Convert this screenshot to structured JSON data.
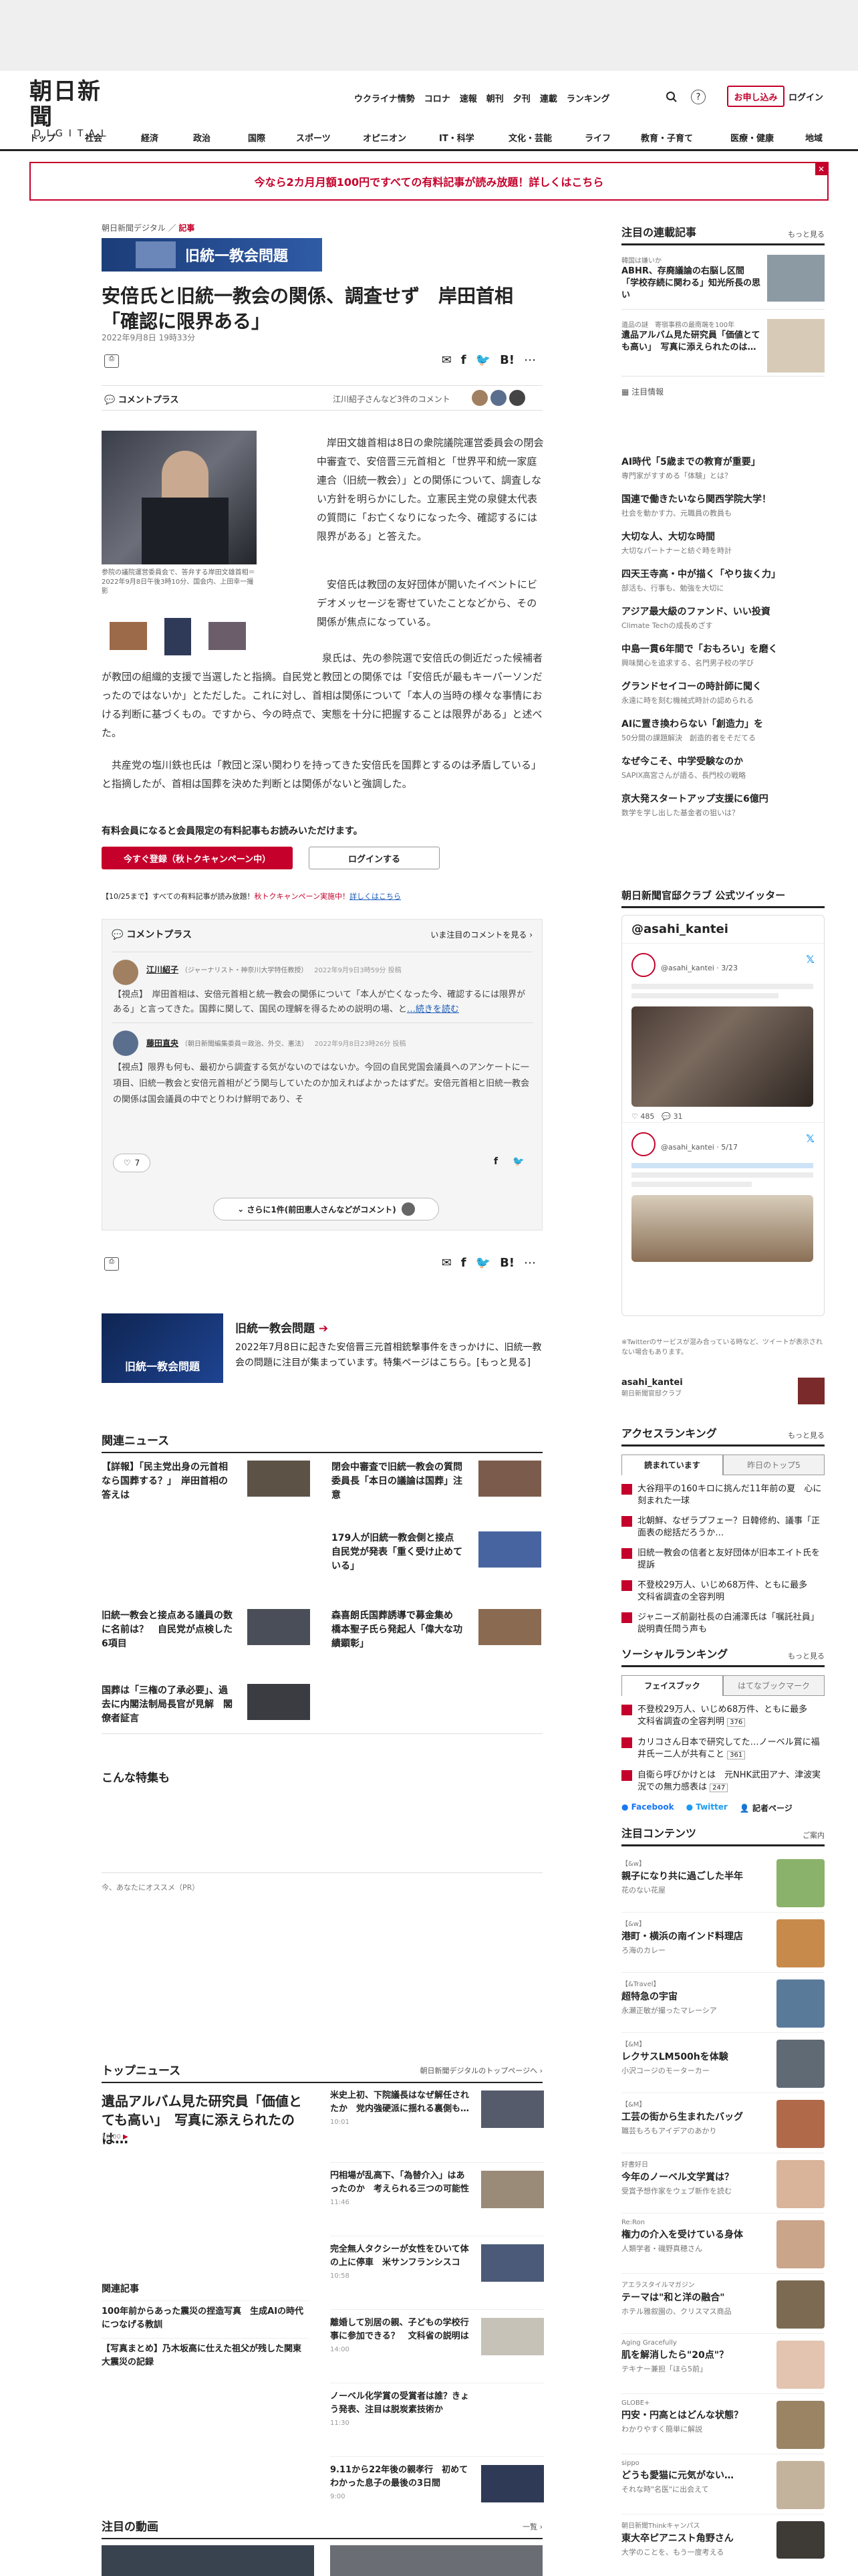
{
  "header": {
    "logo_main": "朝日新聞",
    "logo_sub": "DIGITAL",
    "top_links": [
      "ウクライナ情勢",
      "コロナ",
      "速報",
      "朝刊",
      "夕刊",
      "連載",
      "ランキング"
    ],
    "signup": "お申し込み",
    "login": "ログイン"
  },
  "category_nav": [
    "トップ",
    "社会",
    "経済",
    "政治",
    "国際",
    "スポーツ",
    "オピニオン",
    "IT・科学",
    "文化・芸能",
    "ライフ",
    "教育・子育て",
    "医療・健康",
    "地域"
  ],
  "promo_banner": "今なら2カ月月額100円ですべての有料記事が読み放題！詳しくはこちら",
  "article": {
    "crumb_site": "朝日新聞デジタル",
    "crumb_section": "記事",
    "series_label": "旧統一教会問題",
    "title": "安倍氏と旧統一教会の関係、調査せず　岸田首相「確認に限界ある」",
    "date": "2022年9月8日 19時33分",
    "comment_plus": "コメントプラス",
    "commenters_text": "江川紹子さんなど3件のコメント",
    "photo_caption": "参院の議院運営委員会で、答弁する岸田文雄首相＝2022年9月8日午後3時10分、国会内、上田幸一撮影",
    "para1": "岸田文雄首相は8日の衆院議院運営委員会の閉会中審査で、安倍晋三元首相と「世界平和統一家庭連合（旧統一教会）」との関係について、調査しない方針を明らかにした。立憲民主党の泉健太代表の質問に「お亡くなりになった今、確認するには限界がある」と答えた。",
    "para2": "安倍氏は教団の友好団体が開いたイベントにビデオメッセージを寄せていたことなどから、その関係が焦点になっている。",
    "para3": "泉氏は、先の参院選で安倍氏の側近だった候補者が教団の組織的支援で当選したと指摘。自民党と教団との関係では「安倍氏が最もキーパーソンだったのではないか」とただした。これに対し、首相は関係について「本人の当時の様々な事情における判断に基づくもの。ですから、今の時点で、実態を十分に把握することは限界がある」と述べた。",
    "para4": "共産党の塩川鉄也氏は「教団と深い関わりを持ってきた安倍氏を国葬とするのは矛盾している」と指摘したが、首相は国葬を決めた判断とは関係がないと強調した。",
    "paywall_title": "有料会員になると会員限定の有料記事もお読みいただけます。",
    "btn_register": "今すぐ登録（秋トクキャンペーン中）",
    "btn_login": "ログインする",
    "campaign_note_a": "【10/25まで】すべての有料記事が読み放題！",
    "campaign_note_b": "秋トクキャンペーン実施中！",
    "campaign_note_c": "詳しくはこちら"
  },
  "comments": {
    "header": "コメントプラス",
    "header_right": "いま注目のコメントを見る",
    "c1_name": "江川紹子",
    "c1_role": "（ジャーナリスト・神奈川大学特任教授）",
    "c1_date": "2022年9月9日3時59分 投稿",
    "c1_text": "【視点】　岸田首相は、安倍元首相と統一教会の関係について「本人が亡くなった今、確認するには限界がある」と言ってきた。国葬に関して、国民の理解を得るための説明の場、と",
    "c1_more": "…続きを読む",
    "c2_name": "藤田直央",
    "c2_role": "（朝日新聞編集委員＝政治、外交、憲法）",
    "c2_date": "2022年9月8日23時26分 投稿",
    "c2_text": "【視点】限界も何も、最初から調査する気がないのではないか。今回の自民党国会議員へのアンケートに一項目、旧統一教会と安倍元首相がどう関与していたのか加えればよかったはずだ。安倍元首相と旧統一教会の関係は国会議員の中でとりわけ鮮明であり、そ",
    "likes": "7",
    "more_btn": "さらに1件(前田恵人さんなどがコメント)"
  },
  "promo_series": {
    "title": "旧統一教会問題",
    "desc": "2022年7月8日に起きた安倍晋三元首相銃撃事件をきっかけに、旧統一教会の問題に注目が集まっています。特集ページはこちら。[もっと見る]",
    "thumb_label": "旧統一教会問題"
  },
  "related": {
    "title": "関連ニュース",
    "items": [
      "【詳報】「民主党出身の元首相なら国葬する？」　岸田首相の答えは",
      "閉会中審査で旧統一教会の質問　委員長「本日の議論は国葬」注意",
      "179人が旧統一教会側と接点　自民党が発表「重く受け止めている」",
      "旧統一教会と接点ある議員の数に名前は？　自民党が点検した6項目",
      "森喜朗氏国葬誘導で募金集め 橋本聖子氏ら発起人「偉大な功績顕彰」",
      "国葬は「三権の了承必要」、過去に内閣法制局長官が見解　閣僚者証言"
    ]
  },
  "special": {
    "title": "こんな特集も",
    "recommend": "今、あなたにオススメ（PR）"
  },
  "topnews": {
    "title": "トップニュース",
    "right": "朝日新聞デジタルのトップページへ",
    "lead": "遺品アルバム見た研究員「価値とても高い」　写真に添えられたのは…",
    "lead_time": "12:00",
    "items": [
      {
        "t": "米史上初、下院議長はなぜ解任されたか　党内強硬派に揺れる裏側も…",
        "d": "10:01"
      },
      {
        "t": "円相場が乱高下、「為替介入」はあったのか　考えられる三つの可能性",
        "d": "11:46"
      },
      {
        "t": "完全無人タクシーが女性をひいて体の上に停車　米サンフランシスコ",
        "d": "10:58"
      },
      {
        "t": "離婚して別居の親、子どもの学校行事に参加できる？　文科省の説明は",
        "d": "14:00"
      },
      {
        "t": "ノーベル化学賞の受賞者は誰？きょう発表、注目は脱炭素技術か",
        "d": "11:30"
      },
      {
        "t": "9.11から22年後の親孝行　初めてわかった息子の最後の3日間",
        "d": "9:00"
      }
    ],
    "sub_title": "関連記事",
    "sub_items": [
      "100年前からあった震災の捏造写真　生成AIの時代につなげる教訓",
      "【写真まとめ】乃木坂高に仕えた祖父が残した関東大震災の記録"
    ]
  },
  "videos": {
    "title": "注目の動画",
    "right": "一覧"
  },
  "right": {
    "series_title": "注目の連載記事",
    "series_more": "もっと見る",
    "series_items": [
      {
        "kicker": "韓国は嫌いか",
        "t": "ABHR、存廃議論の右脳し区間「学校存続に関わる」知光所長の思い"
      },
      {
        "kicker": "遺品の謎　寄宿事務の最南端を100年",
        "t": "遺品アルバム見た研究員「価値とても高い」　写真に添えられたのは…"
      }
    ],
    "notice_title": "注目情報",
    "notice": [
      {
        "t": "AI時代「5歳までの教育が重要」",
        "s": "専門家がすすめる「体験」とは？"
      },
      {
        "t": "国連で働きたいなら関西学院大学！",
        "s": "社会を動かす力、元職員の教員も"
      },
      {
        "t": "大切な人、大切な時間",
        "s": "大切なパートナーと紡ぐ時を時計"
      },
      {
        "t": "四天王寺高・中が描く「やり抜く力」",
        "s": "部活も、行事も、勉強を大切に"
      },
      {
        "t": "アジア最大級のファンド、いい投資",
        "s": "Climate Techの成長めざす"
      },
      {
        "t": "中島一貫6年間で「おもろい」を磨く",
        "s": "興味関心を追求する、名門男子校の学び"
      },
      {
        "t": "グランドセイコーの時計師に聞く",
        "s": "永遠に時を刻む機械式時計の認められる"
      },
      {
        "t": "AIに置き換わらない「創造力」を",
        "s": "50分間の課題解決　創造的者をそだてる"
      },
      {
        "t": "なぜ今こそ、中学受験なのか",
        "s": "SAPIX高宮さんが語る、長門校の戦略"
      },
      {
        "t": "京大発スタートアップ支援に6億円",
        "s": "数学を学し出した基金者の狙いは？"
      }
    ],
    "twitter_title": "朝日新聞官邸クラブ 公式ツイッター",
    "twitter_handle": "@asahi_kantei",
    "tweet1_user": "@asahi_kantei · 3/23",
    "tweet1_likes": "485",
    "tweet1_replies": "31",
    "tweet2_user": "@asahi_kantei · 5/17",
    "twitter_note": "※Twitterのサービスが混み合っている時など、ツイートが表示されない場合もあります。",
    "twitter_footer": "asahi_kantei",
    "twitter_footer_sub": "朝日新聞官邸クラブ",
    "access_title": "アクセスランキング",
    "access_more": "もっと見る",
    "access_tabs": [
      "読まれています",
      "昨日のトップ5"
    ],
    "access": [
      "大谷翔平の160キロに挑んだ11年前の夏　心に刻まれた一球",
      "北朝鮮、なぜラプフェー？日韓修約、議事「正面表の総括だろうか…",
      "旧統一教会の信者と友好団体が旧本エイト氏を提訴",
      "不登校29万人、いじめ68万件、ともに最多　文科省調査の全容判明",
      "ジャニーズ前副社長の白浦澤氏は「嘱託社員」　説明責任問う声も"
    ],
    "social_title": "ソーシャルランキング",
    "social_more": "もっと見る",
    "social_tabs": [
      "フェイスブック",
      "はてなブックマーク"
    ],
    "social": [
      {
        "t": "不登校29万人、いじめ68万件、ともに最多　文科省調査の全容判明",
        "n": "376"
      },
      {
        "t": "カリコさん日本で研究してた…ノーベル賞に福井氏ー二人が共有こと",
        "n": "361"
      },
      {
        "t": "自衛ら呼びかけとは　元NHK武田アナ、津波実況での無力感表は",
        "n": "247"
      }
    ],
    "social_links": [
      "Facebook",
      "Twitter",
      "記者ページ"
    ],
    "featured_title": "注目コンテンツ",
    "featured_right": "ご案内",
    "featured": [
      {
        "k": "【&w】",
        "t": "親子になり共に過ごした半年",
        "s": "花のない花屋"
      },
      {
        "k": "【&w】",
        "t": "港町・横浜の南インド料理店",
        "s": "ろ海のカレー"
      },
      {
        "k": "【&Travel】",
        "t": "超特急の宇宙",
        "s": "永瀬正敏が撮ったマレーシア"
      },
      {
        "k": "【&M】",
        "t": "レクサスLM500hを体験",
        "s": "小沢コージのモーターカー"
      },
      {
        "k": "【&M】",
        "t": "工芸の街から生まれたバッグ",
        "s": "職芸もろもアイデアのあかり"
      },
      {
        "k": "好書好日",
        "t": "今年のノーベル文学賞は？",
        "s": "受賞予想作家をウェブ新作を読む"
      },
      {
        "k": "Re:Ron",
        "t": "権力の介入を受けている身体",
        "s": "人類学者・磯野真穂さん"
      },
      {
        "k": "アエラスタイルマガジン",
        "t": "テーマは\"和と洋の融合\"",
        "s": "ホテル雅叙園の、クリスマス商品"
      },
      {
        "k": "Aging Gracefully",
        "t": "肌を解消したら\"20点\"？",
        "s": "テキナー兼担「ほら5前」"
      },
      {
        "k": "GLOBE+",
        "t": "円安・円高とはどんな状態？",
        "s": "わかりやすく簡単に解説"
      },
      {
        "k": "sippo",
        "t": "どうも愛猫に元気がない…",
        "s": "それな時\"名医\"に出会えて"
      },
      {
        "k": "朝日新聞Thinkキャンパス",
        "t": "東大卒ピアニスト角野さん",
        "s": "大学のことを、もう一度考える"
      }
    ]
  }
}
